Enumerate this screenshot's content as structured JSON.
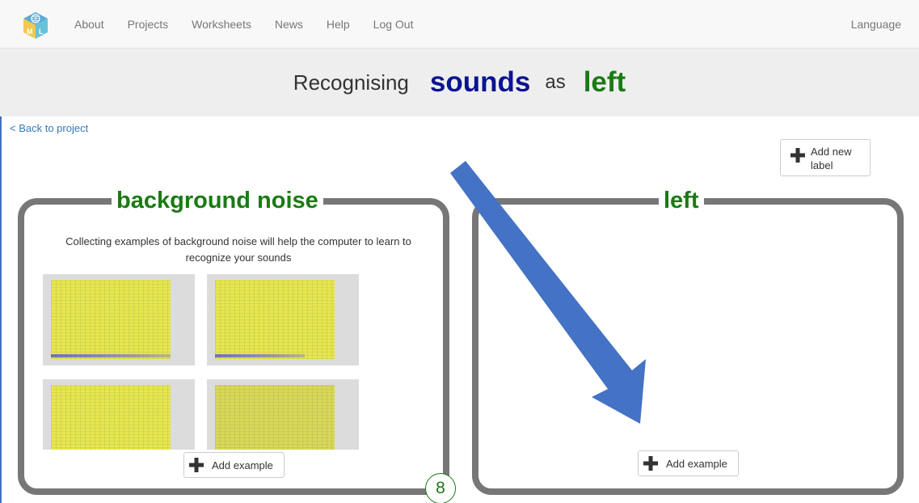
{
  "navbar": {
    "links": [
      "About",
      "Projects",
      "Worksheets",
      "News",
      "Help",
      "Log Out"
    ],
    "language": "Language",
    "logo_letters": [
      "M",
      "L"
    ]
  },
  "banner": {
    "prefix": "Recognising",
    "type": "sounds",
    "connector": "as",
    "label": "left"
  },
  "back_link": "< Back to project",
  "add_label_button": "Add new label",
  "buckets": [
    {
      "title": "background noise",
      "hint": "Collecting examples of background noise will help the computer to learn to recognize your sounds",
      "example_count": 4,
      "add_example": "Add example"
    },
    {
      "title": "left",
      "add_example": "Add example"
    }
  ],
  "step_marker": "8",
  "colors": {
    "label_green": "#1b7a14",
    "type_blue": "#0b1490",
    "arrow_blue": "#4472c4",
    "bucket_border": "#777777"
  }
}
